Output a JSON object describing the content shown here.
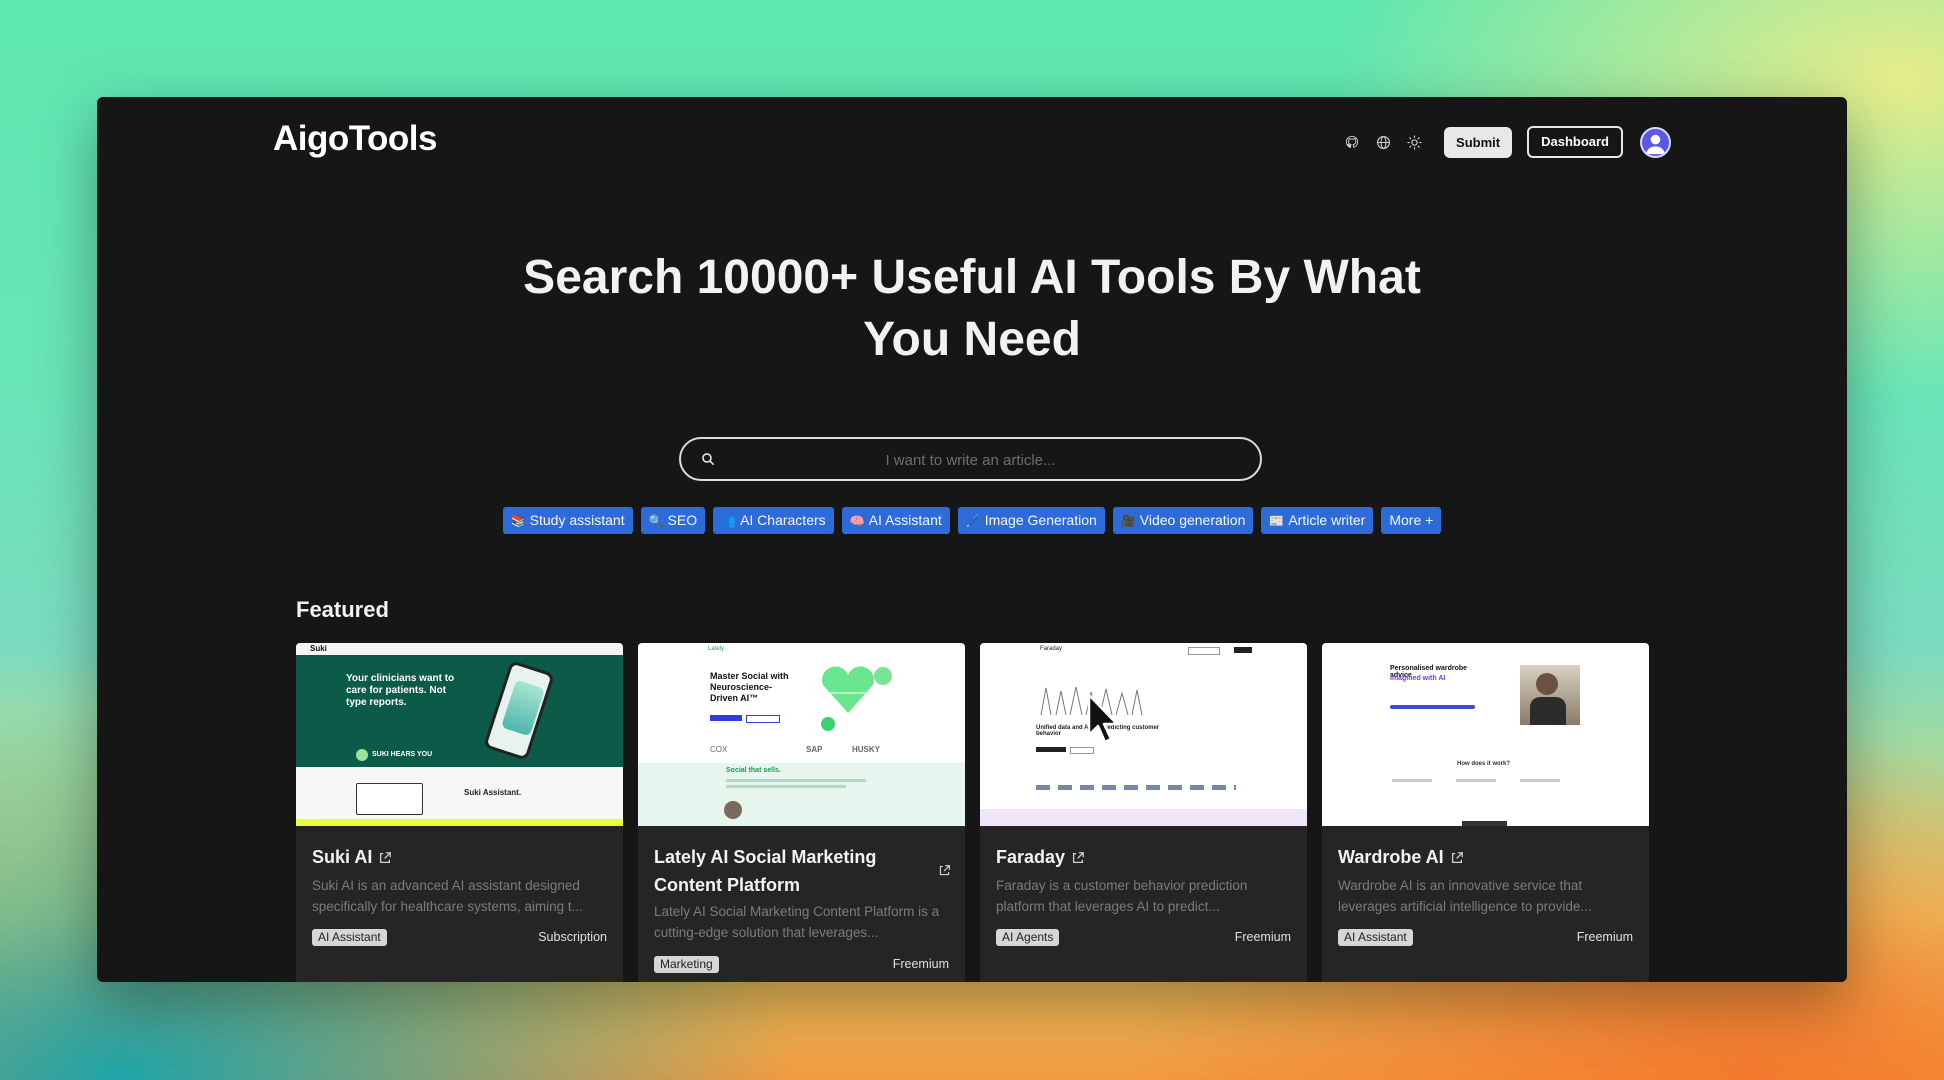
{
  "header": {
    "logo": "AigoTools",
    "icons": [
      "github-icon",
      "globe-icon",
      "sun-icon"
    ],
    "submit_label": "Submit",
    "dashboard_label": "Dashboard"
  },
  "hero": {
    "line1": "Search 10000+ Useful AI Tools By What",
    "line2": "You Need"
  },
  "search": {
    "placeholder": "I want to write an article..."
  },
  "tags": [
    {
      "emoji": "📚",
      "label": "Study assistant"
    },
    {
      "emoji": "🔍",
      "label": "SEO"
    },
    {
      "emoji": "👥",
      "label": "AI Characters"
    },
    {
      "emoji": "🧠",
      "label": "AI Assistant"
    },
    {
      "emoji": "🖊️",
      "label": "Image Generation"
    },
    {
      "emoji": "🎥",
      "label": "Video generation"
    },
    {
      "emoji": "📰",
      "label": "Article writer"
    },
    {
      "emoji": "",
      "label": "More +"
    }
  ],
  "featured": {
    "heading": "Featured",
    "cards": [
      {
        "title": "Suki AI",
        "desc": "Suki AI is an advanced AI assistant designed specifically for healthcare systems, aiming t...",
        "tag": "AI Assistant",
        "pricing": "Subscription",
        "thumb": {
          "headline": "Your clinicians want to care for patients. Not type reports.",
          "sub": "SUKI HEARS YOU",
          "brand": "Suki",
          "caption": "Suki Assistant."
        }
      },
      {
        "title": "Lately AI Social Marketing Content Platform",
        "desc": "Lately AI Social Marketing Content Platform is a cutting-edge solution that leverages...",
        "tag": "Marketing",
        "pricing": "Freemium",
        "thumb": {
          "headline": "Master Social with Neuroscience-Driven AI™",
          "sub": "Social that sells.",
          "brand": "Lately",
          "logos": [
            "COX",
            "SAP",
            "HUSKY"
          ]
        }
      },
      {
        "title": "Faraday",
        "desc": "Faraday is a customer behavior prediction platform that leverages AI to predict...",
        "tag": "AI Agents",
        "pricing": "Freemium",
        "thumb": {
          "headline": "Unified data and AI for predicting customer behavior",
          "brand": "Faraday"
        }
      },
      {
        "title": "Wardrobe AI",
        "desc": "Wardrobe AI is an innovative service that leverages artificial intelligence to provide...",
        "tag": "AI Assistant",
        "pricing": "Freemium",
        "thumb": {
          "headline": "Personalised wardrobe advice",
          "accent": "Imagined with AI",
          "sub": "How does it work?"
        }
      }
    ]
  }
}
